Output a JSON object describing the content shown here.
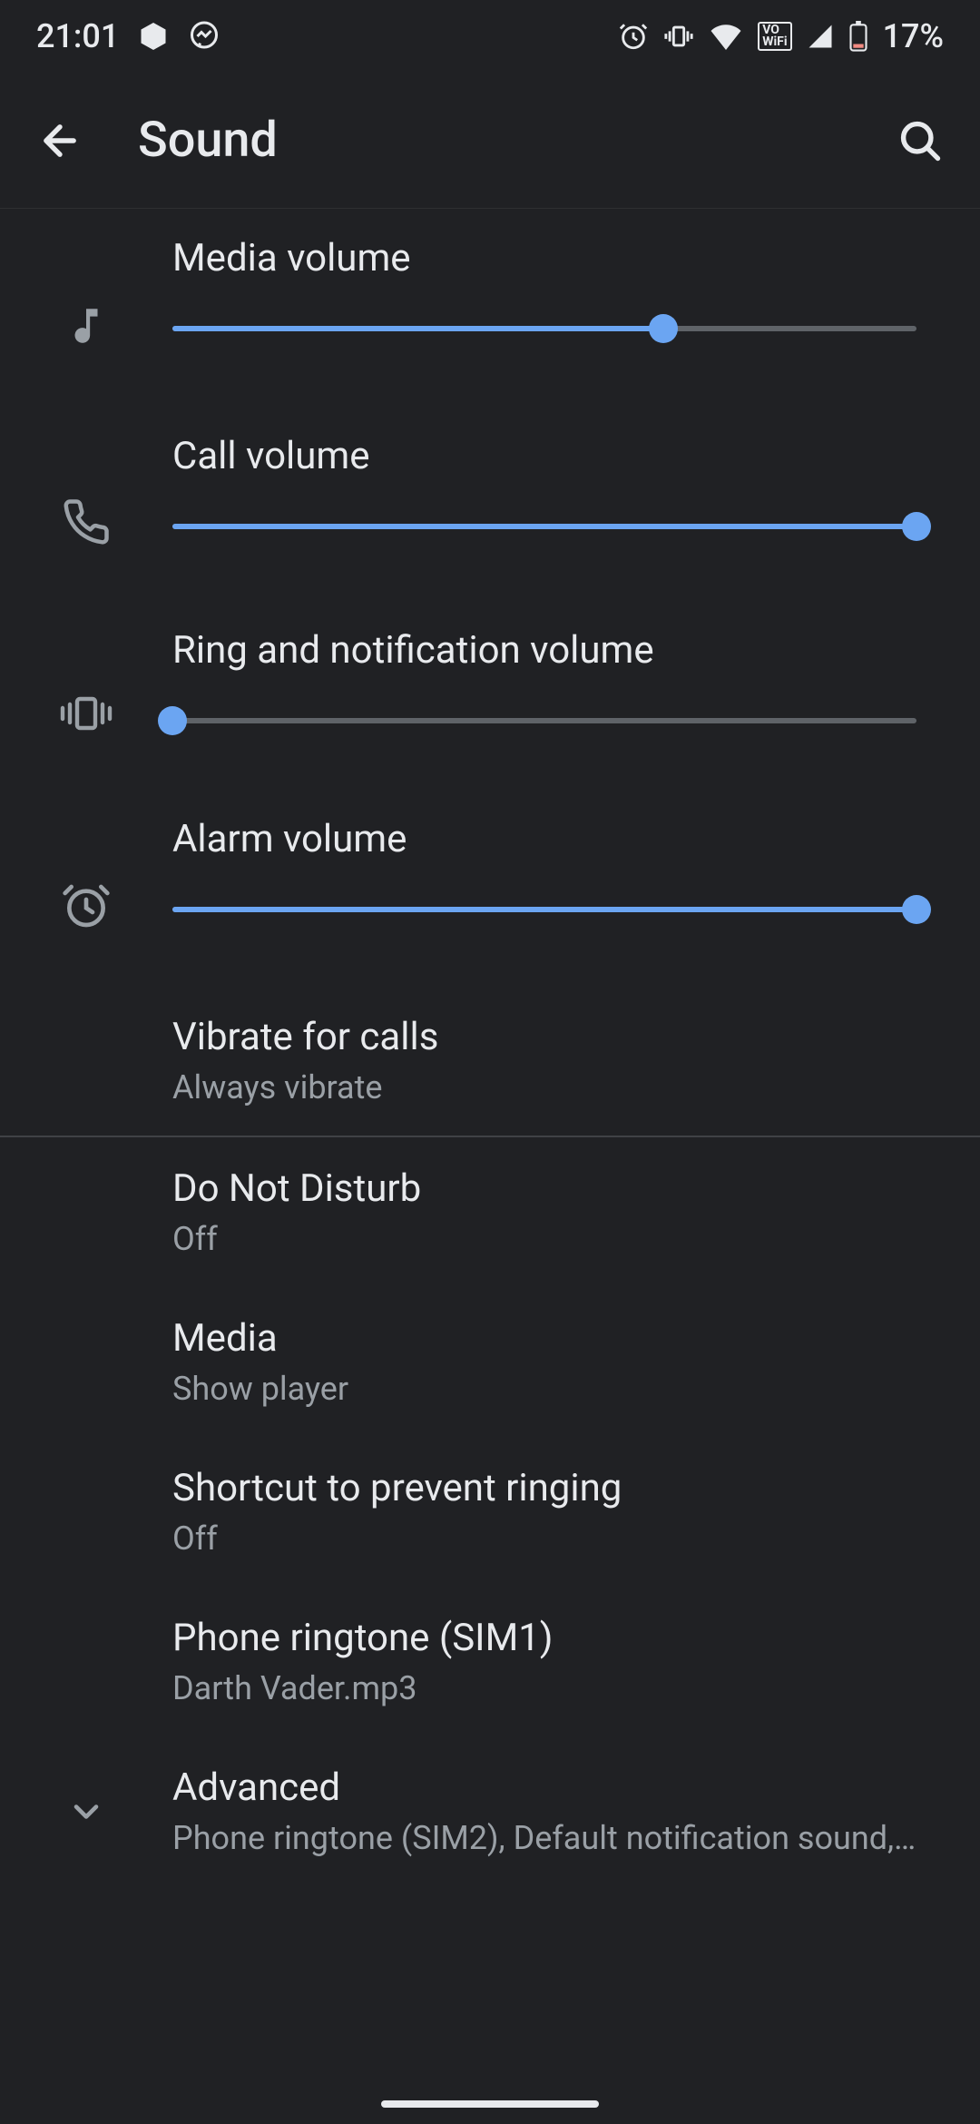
{
  "status": {
    "time": "21:01",
    "battery": "17%"
  },
  "header": {
    "title": "Sound"
  },
  "sliders": {
    "media": {
      "label": "Media volume",
      "value": 66
    },
    "call": {
      "label": "Call volume",
      "value": 100
    },
    "ring": {
      "label": "Ring and notification volume",
      "value": 0
    },
    "alarm": {
      "label": "Alarm volume",
      "value": 100
    }
  },
  "items": {
    "vibrate": {
      "title": "Vibrate for calls",
      "sub": "Always vibrate"
    },
    "dnd": {
      "title": "Do Not Disturb",
      "sub": "Off"
    },
    "media_setting": {
      "title": "Media",
      "sub": "Show player"
    },
    "shortcut": {
      "title": "Shortcut to prevent ringing",
      "sub": "Off"
    },
    "ringtone": {
      "title": "Phone ringtone (SIM1)",
      "sub": "Darth Vader.mp3"
    },
    "advanced": {
      "title": "Advanced",
      "sub": "Phone ringtone (SIM2), Default notification sound,…"
    }
  },
  "colors": {
    "accent": "#6ba5f2",
    "bg": "#202124",
    "text_secondary": "#9aa0a6",
    "icon": "#9aa0a6"
  }
}
